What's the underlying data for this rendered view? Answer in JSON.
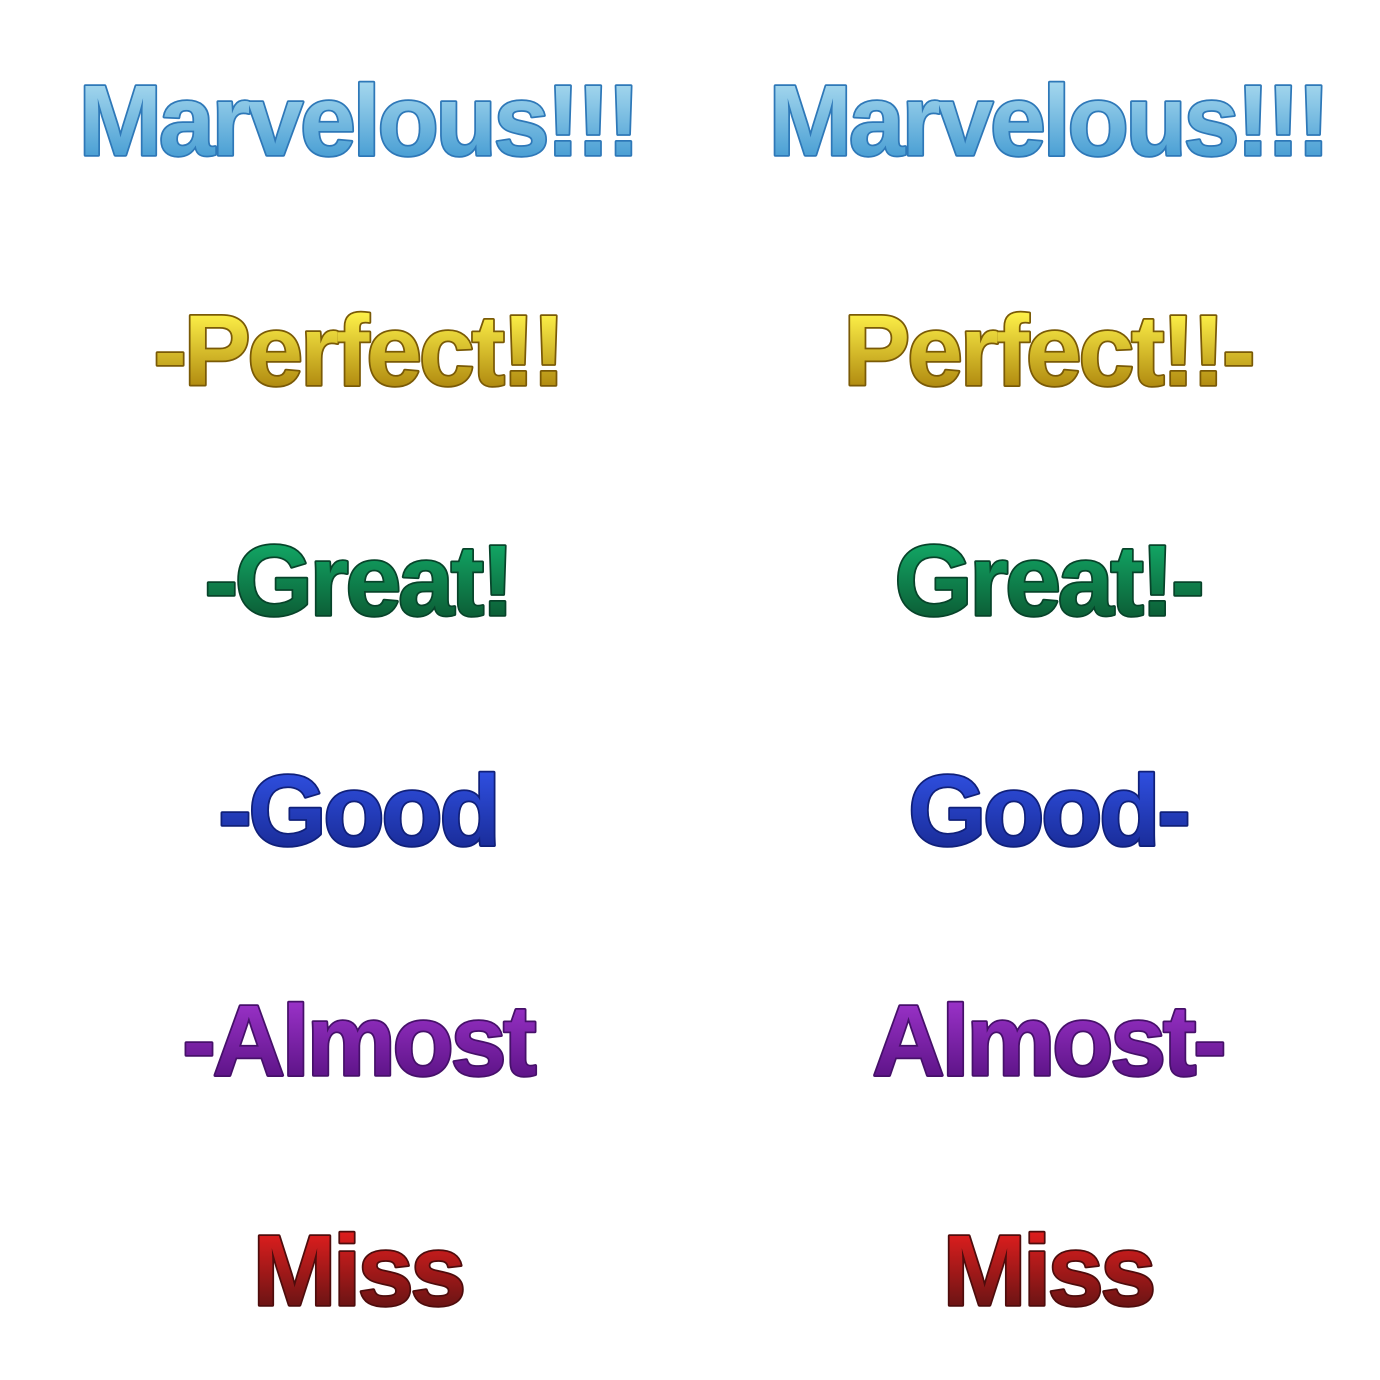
{
  "judgements": [
    {
      "id": "marvelous",
      "left": "Marvelous!!!",
      "right": "Marvelous!!!",
      "top_color": "#a6d8ee",
      "bottom_color": "#4a9fd4",
      "stroke_color": "#2e78b8"
    },
    {
      "id": "perfect",
      "left": "-Perfect!!",
      "right": "Perfect!!-",
      "top_color": "#fff34a",
      "bottom_color": "#b08a10",
      "stroke_color": "#7a5a06"
    },
    {
      "id": "great",
      "left": "-Great!",
      "right": "Great!-",
      "top_color": "#12a866",
      "bottom_color": "#0c5e36",
      "stroke_color": "#07442a"
    },
    {
      "id": "good",
      "left": "-Good",
      "right": "Good-",
      "top_color": "#2f4fe0",
      "bottom_color": "#1a2d9a",
      "stroke_color": "#10207a"
    },
    {
      "id": "almost",
      "left": "-Almost",
      "right": "Almost-",
      "top_color": "#9a32c8",
      "bottom_color": "#5e1488",
      "stroke_color": "#46106a"
    },
    {
      "id": "miss",
      "left": "Miss",
      "right": "Miss",
      "top_color": "#e01e1e",
      "bottom_color": "#6a1414",
      "stroke_color": "#4e0c0c"
    }
  ]
}
